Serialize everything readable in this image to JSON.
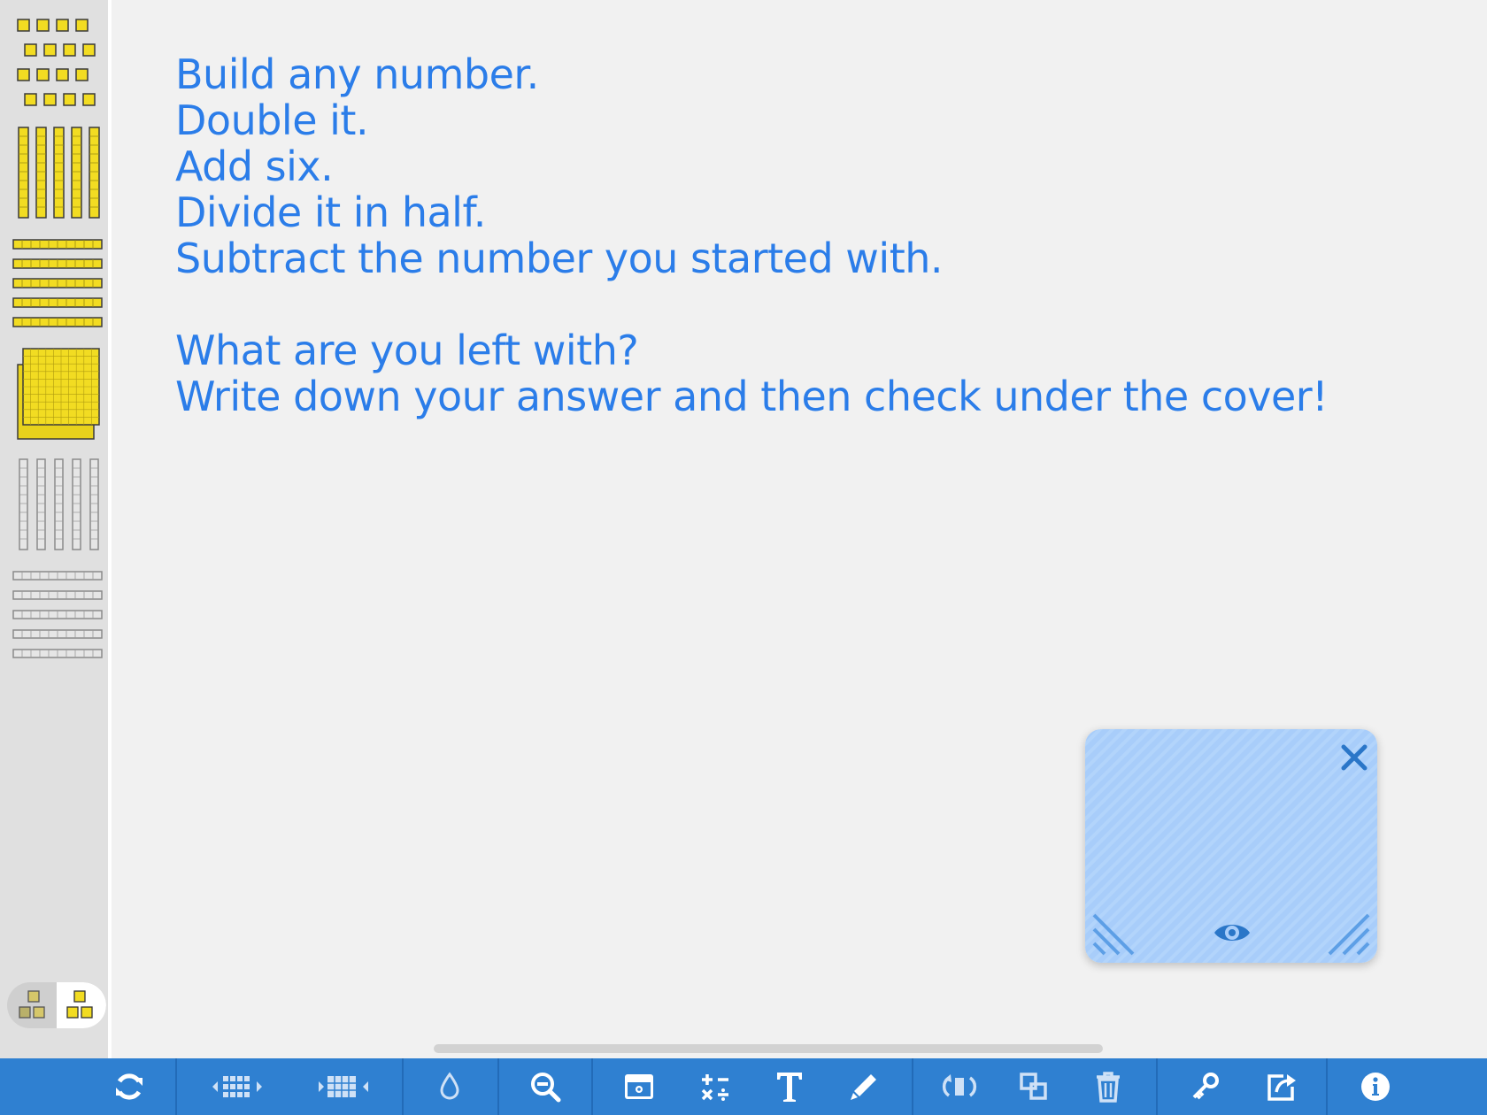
{
  "prompt": {
    "lines": [
      "Build any number.",
      "Double it.",
      "Add six.",
      "Divide it in half.",
      "Subtract the number you started with."
    ],
    "question_lines": [
      "What are you left with?",
      "Write down your answer and then check under the cover!"
    ]
  },
  "sidebar": {
    "items": [
      {
        "name": "ones-cubes",
        "kind": "cube"
      },
      {
        "name": "tens-rods-vertical",
        "kind": "rod"
      },
      {
        "name": "tens-rods-horizontal",
        "kind": "rod"
      },
      {
        "name": "hundreds-flats",
        "kind": "flat"
      },
      {
        "name": "tens-rods-outline-vertical",
        "kind": "outline-rod"
      },
      {
        "name": "tens-rods-outline-horizontal",
        "kind": "outline-rod"
      }
    ],
    "mode_toggle": {
      "options": [
        "shaded-blocks",
        "yellow-blocks"
      ],
      "selected": "yellow-blocks"
    }
  },
  "cover": {
    "close_icon": "close-icon",
    "reveal_icon": "eye-icon"
  },
  "toolbar": {
    "buttons": [
      "reset-icon",
      "regroup-icon",
      "group-icon",
      "fill-color-icon",
      "zoom-out-icon",
      "cover-icon",
      "operations-icon",
      "text-icon",
      "pen-icon",
      "rotate-icon",
      "duplicate-icon",
      "trash-icon",
      "key-icon",
      "share-icon",
      "info-icon"
    ]
  },
  "colors": {
    "accent": "#2f80d1",
    "text": "#2b7de9",
    "block_yellow": "#f2dc22",
    "cover_blue": "#a8cdfa"
  }
}
